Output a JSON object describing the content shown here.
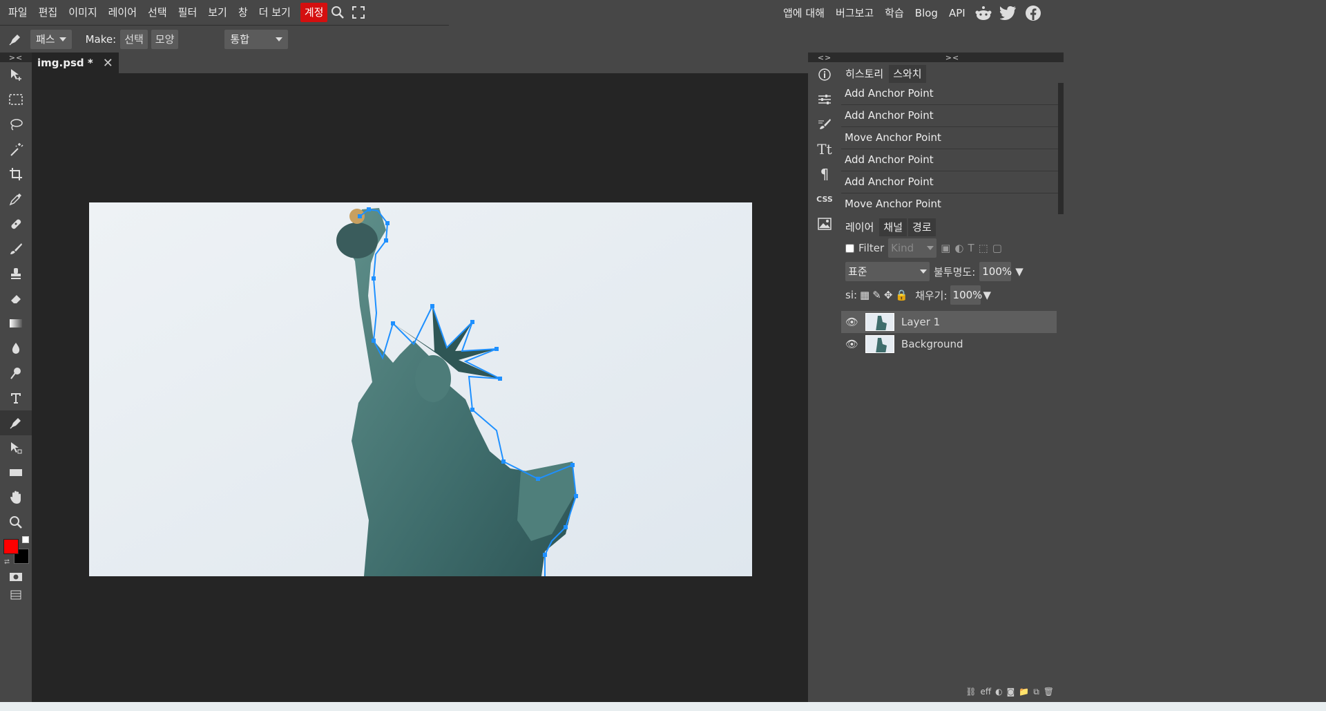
{
  "menu": {
    "items": [
      "파일",
      "편집",
      "이미지",
      "레이어",
      "선택",
      "필터",
      "보기",
      "창",
      "더 보기"
    ],
    "account": "계정",
    "right": [
      "앱에 대해",
      "버그보고",
      "학습",
      "Blog",
      "API"
    ],
    "social_icons": [
      "reddit-icon",
      "twitter-icon",
      "facebook-icon"
    ]
  },
  "options": {
    "mode": "패스",
    "make_label": "Make:",
    "make_selection": "선택",
    "make_shape": "모양",
    "combine": "통합"
  },
  "document": {
    "tab_title": "img.psd *",
    "close_glyph": "✕"
  },
  "colors": {
    "foreground": "#ff0000",
    "background": "#000000",
    "accent": "#d40f0f",
    "path": "#1e90ff"
  },
  "history": {
    "tabs": [
      "히스토리",
      "스와치"
    ],
    "items": [
      "Add Anchor Point",
      "Add Anchor Point",
      "Move Anchor Point",
      "Add Anchor Point",
      "Add Anchor Point",
      "Move Anchor Point"
    ]
  },
  "layers": {
    "tabs": [
      "레이어",
      "채널",
      "경로"
    ],
    "filter_label": "Filter",
    "kind_placeholder": "Kind",
    "blend_mode": "표준",
    "opacity_label": "불투명도:",
    "opacity_value": "100%",
    "lock_label": "si:",
    "fill_label": "채우기:",
    "fill_value": "100%",
    "items": [
      {
        "name": "Layer 1",
        "selected": true
      },
      {
        "name": "Background",
        "selected": false
      }
    ],
    "footer": [
      "link-icon",
      "eff",
      "adjustment-icon",
      "mask-icon",
      "folder-icon",
      "new-layer-icon",
      "trash-icon"
    ],
    "footer_eff": "eff"
  },
  "minipanel": {
    "css_label": "CSS",
    "text_label": "Tt"
  }
}
